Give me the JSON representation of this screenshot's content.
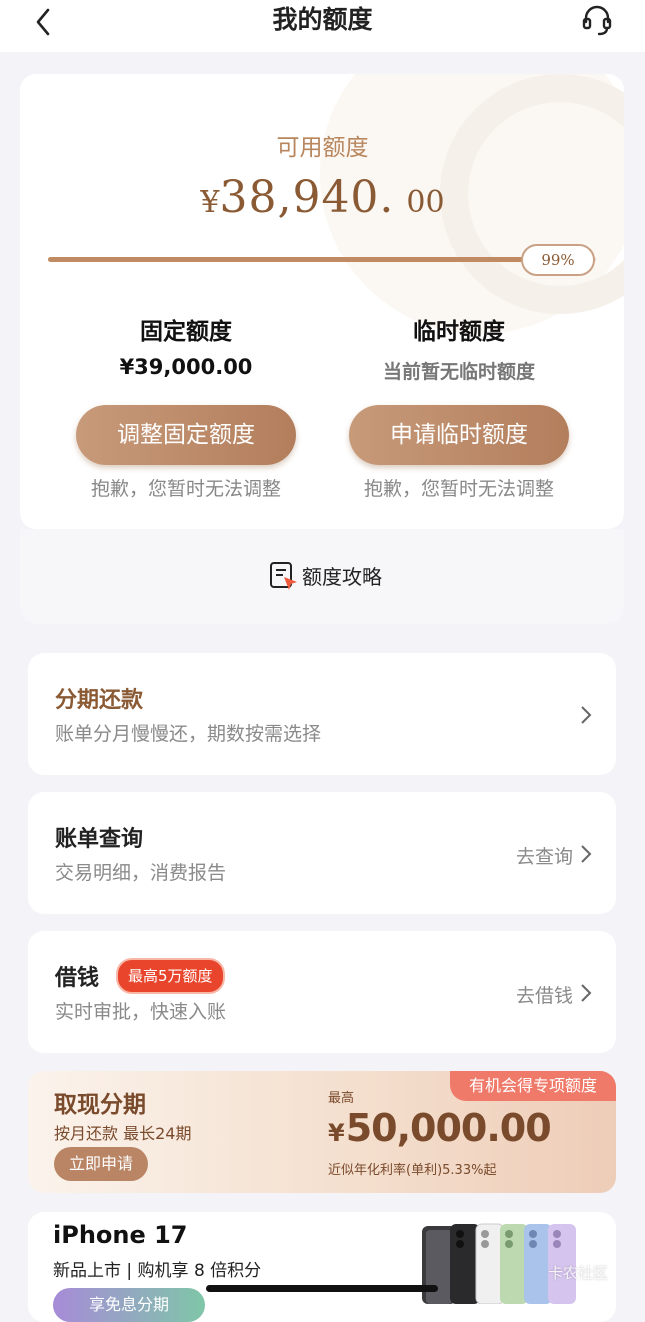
{
  "header": {
    "title": "我的额度"
  },
  "quota": {
    "available_label": "可用额度",
    "currency": "¥",
    "available_int": "38,940.",
    "available_dec": "00",
    "usage_percent_label": "99%",
    "usage_fraction": 0.99,
    "fixed": {
      "title": "固定额度",
      "value": "¥39,000.00",
      "button": "调整固定额度",
      "note": "抱歉，您暂时无法调整"
    },
    "temp": {
      "title": "临时额度",
      "value": "当前暂无临时额度",
      "button": "申请临时额度",
      "note": "抱歉，您暂时无法调整"
    }
  },
  "strategy": {
    "label": "额度攻略"
  },
  "installment": {
    "title": "分期还款",
    "subtitle": "账单分月慢慢还，期数按需选择"
  },
  "bill": {
    "title": "账单查询",
    "subtitle": "交易明细，消费报告",
    "action": "去查询"
  },
  "loan": {
    "title": "借钱",
    "tag": "最高5万额度",
    "subtitle": "实时审批，快速入账",
    "action": "去借钱"
  },
  "cash": {
    "tag": "有机会得专项额度",
    "title": "取现分期",
    "subtitle": "按月还款 最长24期",
    "button": "立即申请",
    "max_label": "最高",
    "currency": "¥",
    "amount": "50,000.00",
    "rate": "近似年化利率(单利)5.33%起"
  },
  "iphone": {
    "title": "iPhone 17",
    "subtitle": "新品上市 | 购机享 8 倍积分",
    "button": "享免息分期"
  },
  "watermark": "卡农社区",
  "colors": {
    "accent": "#b8865c",
    "brown_dark": "#8a5a34",
    "tag_red": "#e8452c"
  }
}
